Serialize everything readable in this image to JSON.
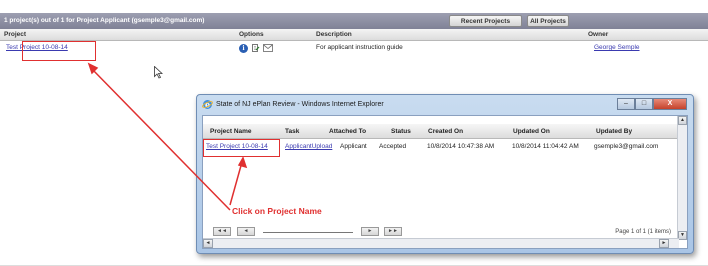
{
  "outer": {
    "count_text": "1 project(s) out of 1 for Project Applicant (gsemple3@gmail.com)",
    "buttons": {
      "recent": "Recent Projects",
      "all": "All Projects"
    },
    "columns": {
      "project": "Project",
      "options": "Options",
      "description": "Description",
      "owner": "Owner"
    },
    "row": {
      "project": "Test Project 10-08-14",
      "description": "For applicant instruction guide",
      "owner": "George Semple",
      "option_icons": [
        "info-icon",
        "document-icon",
        "mail-icon"
      ]
    }
  },
  "ie_window": {
    "title": "State of NJ ePlan Review - Windows Internet Explorer",
    "controls": {
      "minimize": "–",
      "maximize": "□",
      "close": "X"
    },
    "columns": {
      "project_name": "Project Name",
      "task": "Task",
      "attached_to": "Attached To",
      "status": "Status",
      "created_on": "Created On",
      "updated_on": "Updated On",
      "updated_by": "Updated By"
    },
    "row": {
      "project_name": "Test Project 10-08-14",
      "task": "ApplicantUpload",
      "attached_to": "Applicant",
      "status": "Accepted",
      "created_on": "10/8/2014 10:47:38 AM",
      "updated_on": "10/8/2014 11:04:42 AM",
      "updated_by": "gsemple3@gmail.com"
    },
    "pager": {
      "first": "◄◄",
      "prev": "◄",
      "next": "►",
      "last": "►►",
      "info": "Page 1 of 1 (1 items)"
    }
  },
  "annotation": {
    "callout": "Click on Project Name"
  },
  "colors": {
    "accent_red": "#e03030",
    "link_blue": "#3a3ab0",
    "header_gray": "#8a8ca0"
  }
}
